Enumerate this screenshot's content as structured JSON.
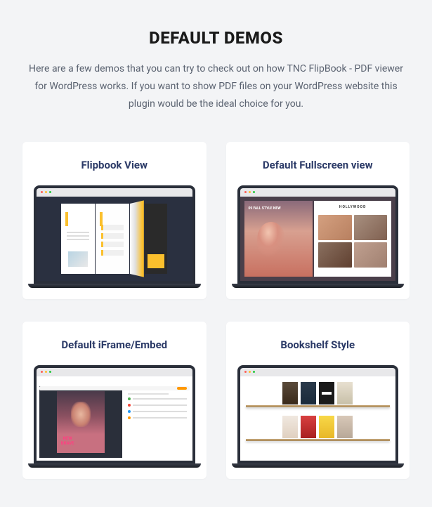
{
  "heading": "DEFAULT DEMOS",
  "subtitle": "Here are a few demos that you can try to check out on how TNC FlipBook - PDF viewer for WordPress works. If you want to show PDF files on your WordPress website this plugin would be the ideal choice for you.",
  "cards": [
    {
      "title": "Flipbook View"
    },
    {
      "title": "Default Fullscreen view"
    },
    {
      "title": "Default iFrame/Embed"
    },
    {
      "title": "Bookshelf Style"
    }
  ],
  "demo2": {
    "leftBadge": "09\nFALL\nSTYLE\nNEW",
    "rightTitle": "HOLLYWOOD"
  },
  "demo3": {
    "photoTextPrefix": "NEW ",
    "photoTextAccent": "",
    "photoTextSuffix": "BRAVE"
  }
}
